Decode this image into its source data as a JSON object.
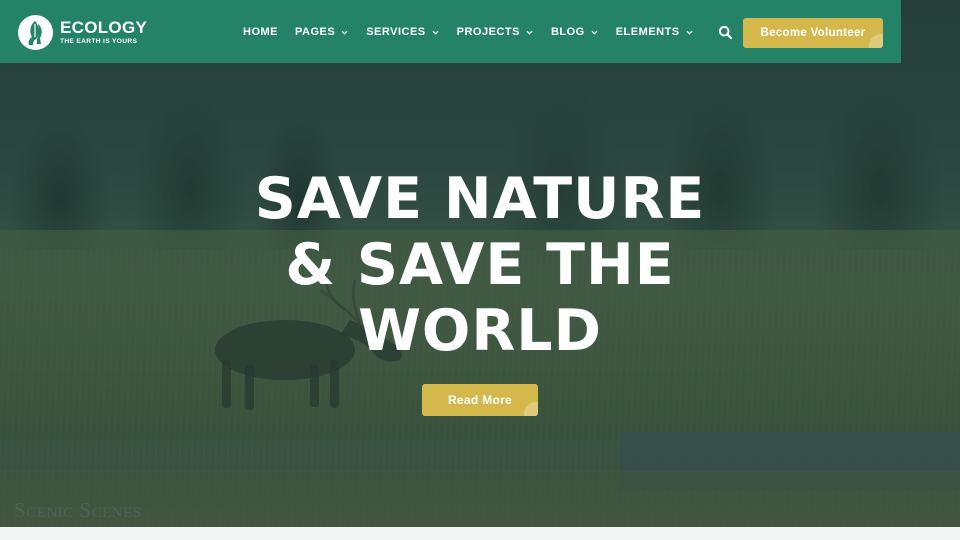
{
  "brand": {
    "name": "ECOLOGY",
    "tagline": "THE EARTH IS YOURS",
    "icon": "hand-leaf-logo"
  },
  "nav": {
    "items": [
      {
        "label": "HOME",
        "has_dropdown": false
      },
      {
        "label": "PAGES",
        "has_dropdown": true
      },
      {
        "label": "SERVICES",
        "has_dropdown": true
      },
      {
        "label": "PROJECTS",
        "has_dropdown": true
      },
      {
        "label": "BLOG",
        "has_dropdown": true
      },
      {
        "label": "ELEMENTS",
        "has_dropdown": true
      }
    ],
    "search_icon": "search-icon",
    "cta_label": "Become Volunteer"
  },
  "hero": {
    "headline_lines": [
      "SAVE NATURE",
      "& SAVE THE",
      "WORLD"
    ],
    "button_label": "Read More",
    "watermark": "Scenic Scenes"
  },
  "colors": {
    "header_bg": "#248267",
    "accent": "#d5b84c",
    "text_light": "#ffffff"
  }
}
